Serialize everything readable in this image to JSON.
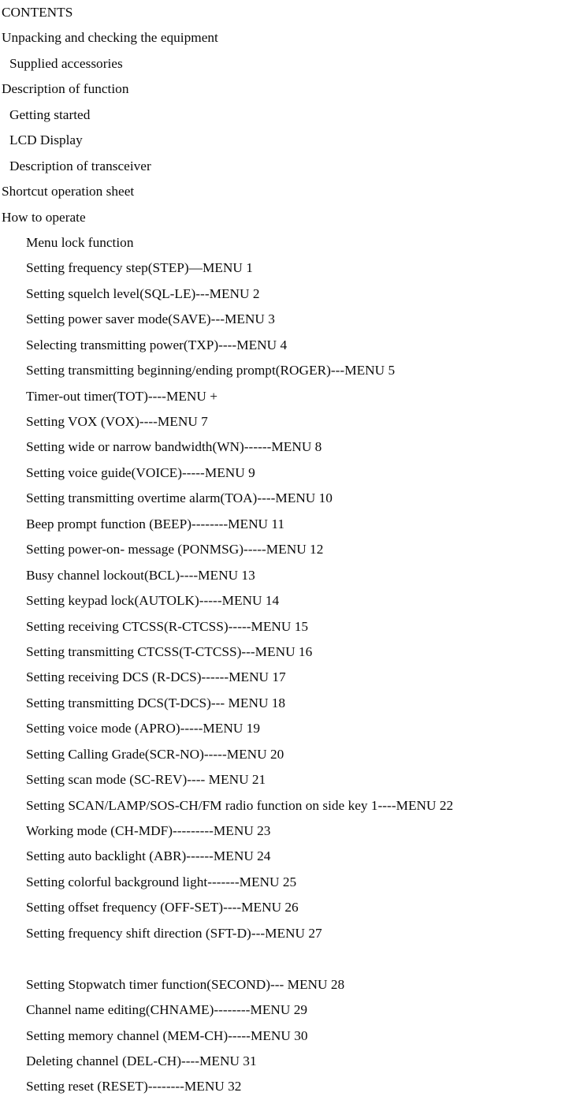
{
  "document": {
    "title": "CONTENTS",
    "background_color": "#ffffff",
    "text_color": "#000000",
    "lines": [
      {
        "text": "CONTENTS",
        "indent": 0
      },
      {
        "text": "Unpacking and checking the equipment",
        "indent": 0
      },
      {
        "text": "Supplied accessories",
        "indent": 1
      },
      {
        "text": "Description of function",
        "indent": 0
      },
      {
        "text": "Getting started",
        "indent": 1
      },
      {
        "text": "LCD Display",
        "indent": 1
      },
      {
        "text": "Description of transceiver",
        "indent": 1
      },
      {
        "text": "Shortcut operation sheet",
        "indent": 0
      },
      {
        "text": "How to operate",
        "indent": 0
      },
      {
        "text": "Menu lock function",
        "indent": 2
      },
      {
        "text": "Setting frequency step(STEP)—MENU 1",
        "indent": 2
      },
      {
        "text": "Setting squelch level(SQL-LE)---MENU 2",
        "indent": 2
      },
      {
        "text": "Setting power saver mode(SAVE)---MENU 3",
        "indent": 2
      },
      {
        "text": "Selecting transmitting power(TXP)----MENU 4",
        "indent": 2
      },
      {
        "text": "Setting transmitting beginning/ending prompt(ROGER)---MENU 5",
        "indent": 2
      },
      {
        "text": "Timer-out timer(TOT)----MENU +",
        "indent": 2
      },
      {
        "text": "Setting VOX (VOX)----MENU 7",
        "indent": 2
      },
      {
        "text": "Setting wide or narrow bandwidth(WN)------MENU 8",
        "indent": 2
      },
      {
        "text": "Setting voice guide(VOICE)-----MENU 9",
        "indent": 2
      },
      {
        "text": "Setting transmitting overtime alarm(TOA)----MENU 10",
        "indent": 2
      },
      {
        "text": "Beep prompt function (BEEP)--------MENU 11",
        "indent": 2
      },
      {
        "text": "Setting power-on- message (PONMSG)-----MENU 12",
        "indent": 2
      },
      {
        "text": "Busy channel lockout(BCL)----MENU 13",
        "indent": 2
      },
      {
        "text": "Setting keypad lock(AUTOLK)-----MENU 14",
        "indent": 2
      },
      {
        "text": "Setting receiving CTCSS(R-CTCSS)-----MENU 15",
        "indent": 2
      },
      {
        "text": "Setting transmitting CTCSS(T-CTCSS)---MENU 16",
        "indent": 2
      },
      {
        "text": "Setting receiving DCS (R-DCS)------MENU 17",
        "indent": 2
      },
      {
        "text": "Setting transmitting DCS(T-DCS)--- MENU 18",
        "indent": 2
      },
      {
        "text": "Setting voice mode (APRO)-----MENU 19",
        "indent": 2
      },
      {
        "text": "Setting Calling Grade(SCR-NO)-----MENU 20",
        "indent": 2
      },
      {
        "text": "Setting scan mode (SC-REV)---- MENU 21",
        "indent": 2
      },
      {
        "text": "Setting SCAN/LAMP/SOS-CH/FM radio function on side key 1----MENU 22",
        "indent": 2
      },
      {
        "text": "Working mode (CH-MDF)---------MENU 23",
        "indent": 2
      },
      {
        "text": "Setting auto backlight (ABR)------MENU 24",
        "indent": 2
      },
      {
        "text": "Setting colorful background light-------MENU 25",
        "indent": 2
      },
      {
        "text": "Setting offset frequency (OFF-SET)----MENU 26",
        "indent": 2
      },
      {
        "text": "Setting frequency shift direction (SFT-D)---MENU 27",
        "indent": 2
      },
      {
        "text": "",
        "indent": 2
      },
      {
        "text": "Setting Stopwatch timer function(SECOND)--- MENU 28",
        "indent": 2
      },
      {
        "text": "Channel name editing(CHNAME)--------MENU 29",
        "indent": 2
      },
      {
        "text": "Setting memory channel (MEM-CH)-----MENU 30",
        "indent": 2
      },
      {
        "text": "Deleting channel (DEL-CH)----MENU 31",
        "indent": 2
      },
      {
        "text": "Setting reset (RESET)--------MENU 32",
        "indent": 2
      }
    ]
  }
}
